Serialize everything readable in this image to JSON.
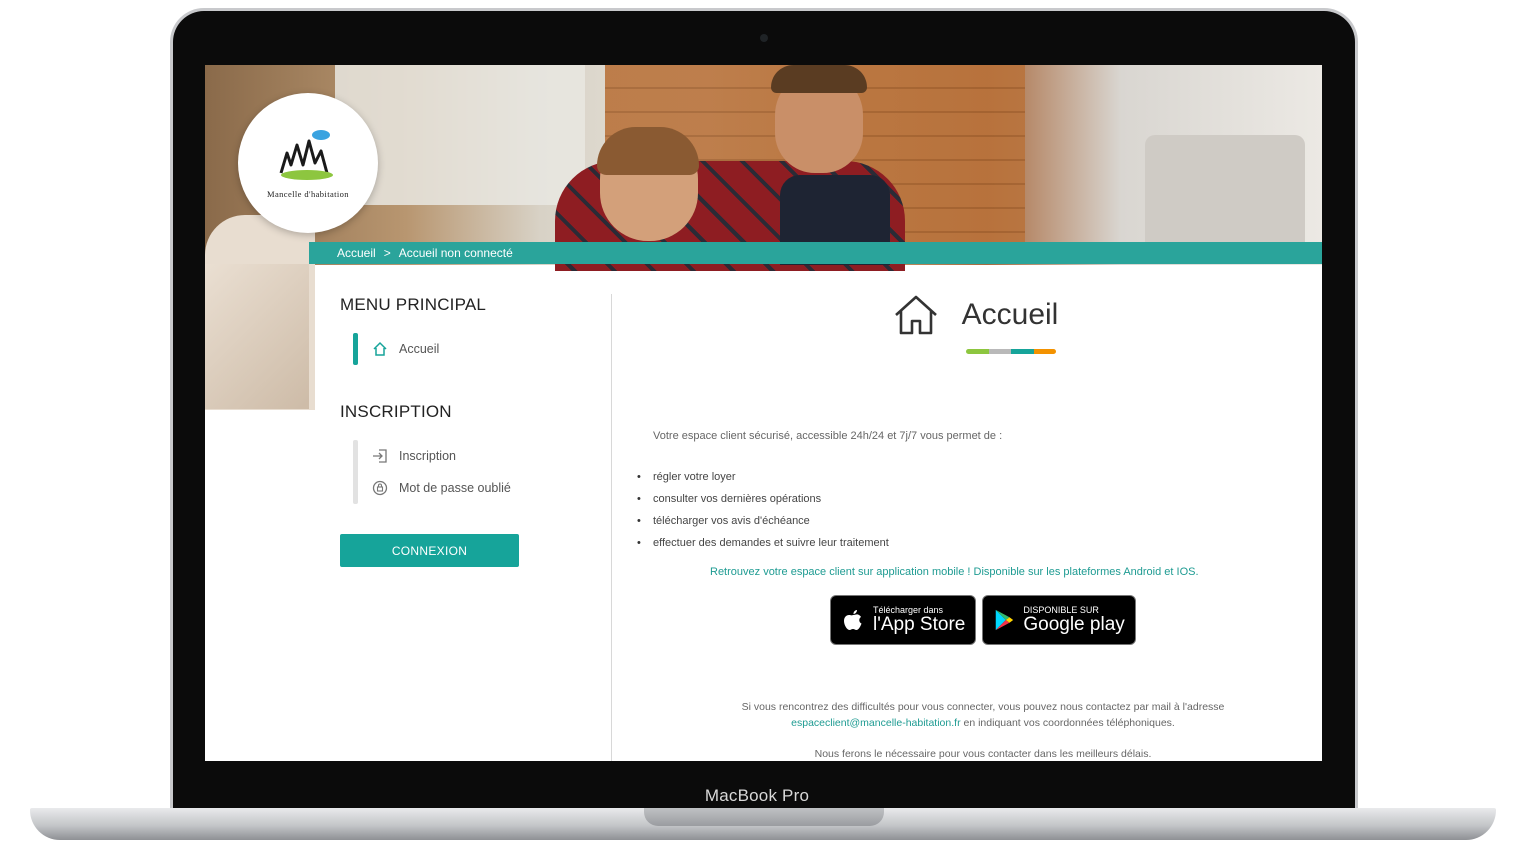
{
  "device": {
    "label": "MacBook Pro"
  },
  "header": {
    "logo_text": "Mancelle d'habitation",
    "breadcrumb": {
      "home": "Accueil",
      "separator": ">",
      "current": "Accueil non connecté"
    }
  },
  "sidebar": {
    "menu_heading": "MENU PRINCIPAL",
    "menu_items": [
      {
        "label": "Accueil",
        "icon": "home-icon"
      }
    ],
    "inscription_heading": "INSCRIPTION",
    "inscription_items": [
      {
        "label": "Inscription",
        "icon": "sign-in-icon"
      },
      {
        "label": "Mot de passe oublié",
        "icon": "password-icon"
      }
    ],
    "connect_label": "CONNEXION"
  },
  "main": {
    "title": "Accueil",
    "intro": "Votre espace client sécurisé, accessible 24h/24 et 7j/7 vous permet de :",
    "features": [
      "régler votre loyer",
      "consulter vos dernières opérations",
      "télécharger vos avis d'échéance",
      "effectuer des demandes et suivre leur traitement"
    ],
    "promo": "Retrouvez votre espace client sur application mobile ! Disponible sur les plateformes Android et IOS.",
    "app_store": {
      "small": "Télécharger dans",
      "big": "l'App Store"
    },
    "google_play": {
      "small": "DISPONIBLE SUR",
      "big": "Google play"
    },
    "help_text": "Si vous rencontrez des difficultés pour vous connecter, vous pouvez nous contactez par mail à l'adresse",
    "help_email": "espaceclient@mancelle-habitation.fr",
    "help_suffix": "en indiquant vos coordonnées téléphoniques.",
    "note": "Nous ferons le nécessaire pour vous contacter dans les meilleurs délais."
  },
  "colors": {
    "accent": "#16a49a",
    "accent_bar": [
      "#8dc63f",
      "#b9b9b9",
      "#16a49a",
      "#f39200"
    ],
    "menu_active_bar": "#16a49a",
    "menu_inactive_bar": "#e2e2e2"
  }
}
